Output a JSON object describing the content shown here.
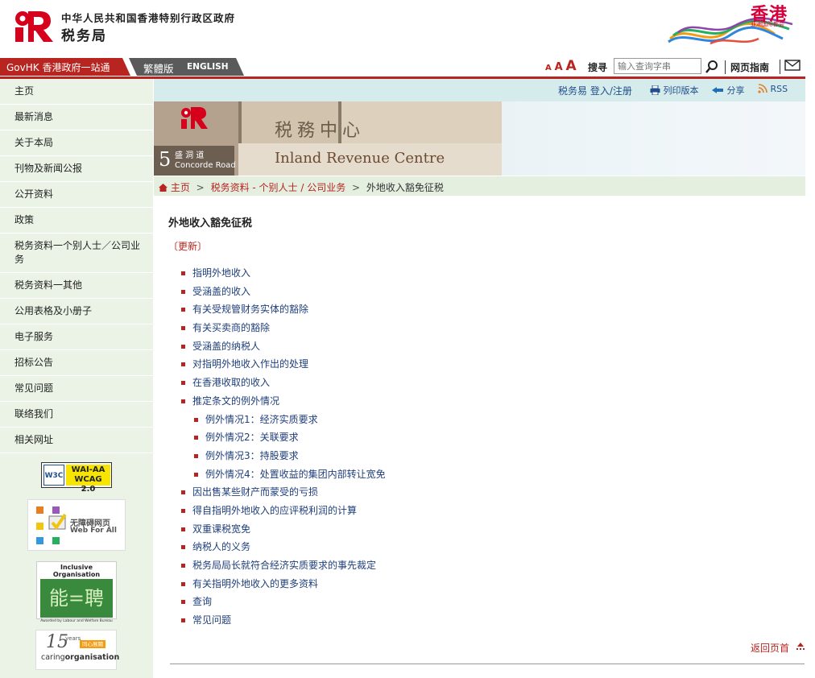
{
  "header": {
    "gov_name": "中华人民共和国香港特别行政区政府",
    "dept_name": "税务局",
    "brand_title": "香港",
    "brand_subtitle": "亚洲国际都会"
  },
  "topbar": {
    "govhk": "GovHK 香港政府一站通",
    "lang_trad": "繁體版",
    "lang_en": "ENGLISH",
    "font_sizes": [
      "A",
      "A",
      "A"
    ],
    "search_label": "搜寻",
    "search_placeholder": "输入查询字串",
    "guide": "网页指南"
  },
  "sidebar": {
    "items": [
      {
        "label": "主页"
      },
      {
        "label": "最新消息"
      },
      {
        "label": "关于本局"
      },
      {
        "label": "刊物及新闻公报"
      },
      {
        "label": "公开资料"
      },
      {
        "label": "政策"
      },
      {
        "label": "税务资料一个别人士／公司业务"
      },
      {
        "label": "税务资料一其他"
      },
      {
        "label": "公用表格及小册子"
      },
      {
        "label": "电子服务"
      },
      {
        "label": "招标公告"
      },
      {
        "label": "常见问题"
      },
      {
        "label": "联络我们"
      },
      {
        "label": "相关网址"
      }
    ],
    "badges": {
      "w3c": "W3C",
      "wcag_line1": "WAI-AA",
      "wcag_line2": "WCAG 2.0",
      "web_for_all_cn": "无障碍网页",
      "web_for_all_en": "Web For All",
      "inclusive_title": "Inclusive Organisation",
      "inclusive_glyph": "能=聘",
      "inclusive_footer": "Awarded by Labour and Welfare Bureau",
      "caring_years": "15",
      "caring_years_label": "years",
      "caring_cn": "同心展關懷",
      "caring_en_1": "caring",
      "caring_en_2": "organisation"
    }
  },
  "utilbar": {
    "etax": "税务易 登入/注册",
    "print": "列印版本",
    "share": "分享",
    "rss": "RSS"
  },
  "banner": {
    "sign_cn": "税務中心",
    "sign_en": "Inland Revenue Centre",
    "address_num": "5",
    "address_cn": "盛 洞 道",
    "address_en": "Concorde Road"
  },
  "breadcrumb": {
    "home": "主页",
    "section": "税务资料 - 个别人士 / 公司业务",
    "current": "外地收入豁免征税"
  },
  "main": {
    "title": "外地收入豁免征税",
    "update": "〔更新〕",
    "items": [
      {
        "label": "指明外地收入",
        "sub": false
      },
      {
        "label": "受涵盖的收入",
        "sub": false
      },
      {
        "label": "有关受规管财务实体的豁除",
        "sub": false
      },
      {
        "label": "有关买卖商的豁除",
        "sub": false
      },
      {
        "label": "受涵盖的纳税人",
        "sub": false
      },
      {
        "label": "对指明外地收入作出的处理",
        "sub": false
      },
      {
        "label": "在香港收取的收入",
        "sub": false
      },
      {
        "label": "推定条文的例外情况",
        "sub": false
      },
      {
        "label": "例外情况1：经济实质要求",
        "sub": true
      },
      {
        "label": "例外情况2：关联要求",
        "sub": true
      },
      {
        "label": "例外情况3：持股要求",
        "sub": true
      },
      {
        "label": "例外情况4：处置收益的集团内部转让宽免",
        "sub": true
      },
      {
        "label": "因出售某些财产而蒙受的亏损",
        "sub": false
      },
      {
        "label": "得自指明外地收入的应评税利润的计算",
        "sub": false
      },
      {
        "label": "双重课税宽免",
        "sub": false
      },
      {
        "label": "纳税人的义务",
        "sub": false
      },
      {
        "label": "税务局局长就符合经济实质要求的事先裁定",
        "sub": false
      },
      {
        "label": "有关指明外地收入的更多资料",
        "sub": false
      },
      {
        "label": "查询",
        "sub": false
      },
      {
        "label": "常见问题",
        "sub": false
      }
    ],
    "back_to_top": "返回页首"
  },
  "colors": {
    "brand_red": "#b8241f",
    "link_blue": "#1f3f7a",
    "sidebar_bg": "#eaf3e6",
    "utilbar_bg": "#d6ecec"
  }
}
